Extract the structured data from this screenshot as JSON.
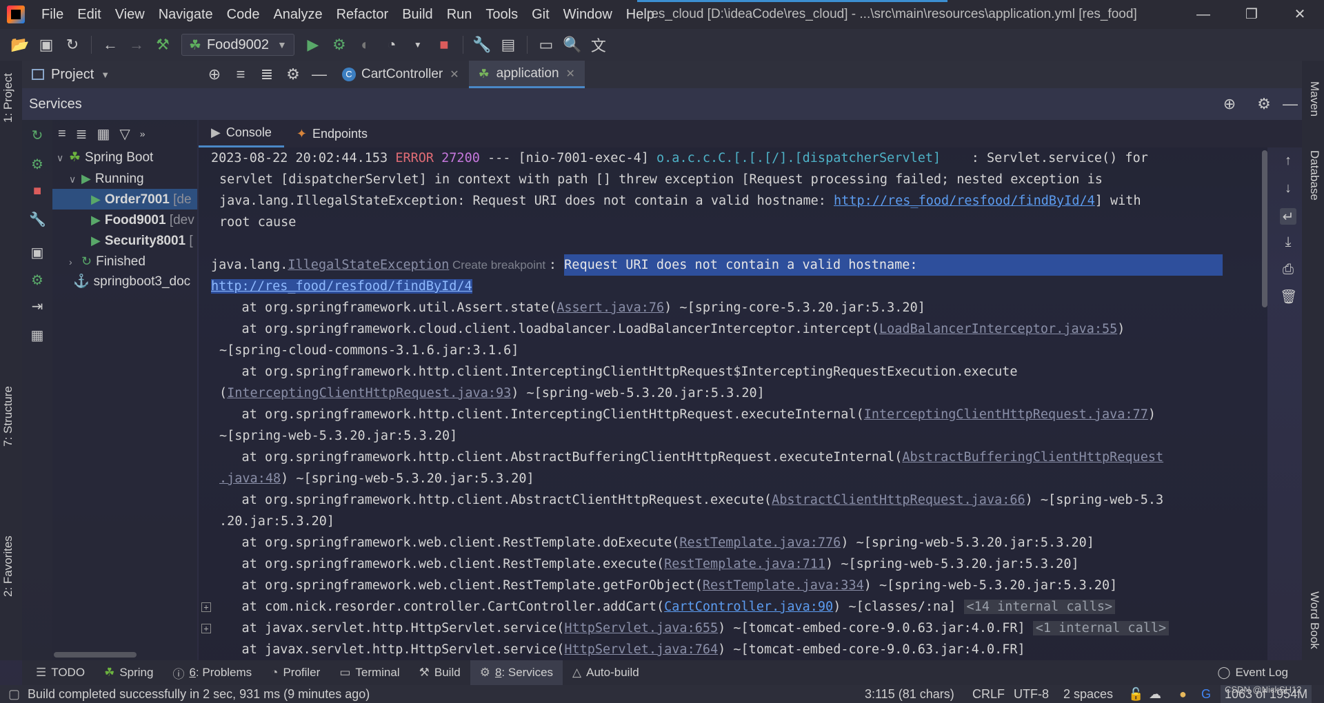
{
  "menubar": {
    "items": [
      "File",
      "Edit",
      "View",
      "Navigate",
      "Code",
      "Analyze",
      "Refactor",
      "Build",
      "Run",
      "Tools",
      "Git",
      "Window",
      "Help"
    ],
    "title": "res_cloud [D:\\ideaCode\\res_cloud] - ...\\src\\main\\resources\\application.yml [res_food]"
  },
  "toolbar": {
    "run_config": "Food9002"
  },
  "left_stripe": {
    "project": "1: Project",
    "structure": "7: Structure",
    "favorites": "2: Favorites"
  },
  "right_stripe": {
    "maven": "Maven",
    "database": "Database",
    "wordbook": "Word Book"
  },
  "tabs_row": {
    "project_label": "Project",
    "tabs": [
      {
        "label": "CartController",
        "active": false
      },
      {
        "label": "application",
        "active": true
      }
    ]
  },
  "services": {
    "title": "Services",
    "tree": {
      "spring_boot": "Spring Boot",
      "running": "Running",
      "apps": [
        {
          "name": "Order7001",
          "suffix": "[de",
          "selected": true
        },
        {
          "name": "Food9001",
          "suffix": "[dev",
          "selected": false
        },
        {
          "name": "Security8001",
          "suffix": "[",
          "selected": false
        }
      ],
      "finished": "Finished",
      "docker": "springboot3_doc"
    },
    "console_tabs": [
      "Console",
      "Endpoints"
    ]
  },
  "console": {
    "l1_ts": "2023-08-22 20:02:44.153 ",
    "l1_level": "ERROR",
    "l1_pid": " 27200",
    "l1_thread": " --- [nio-7001-exec-4] ",
    "l1_logger": "o.a.c.c.C.[.[.[/].[dispatcherServlet]",
    "l1_msg": "    : Servlet.service() for",
    "l2": "servlet [dispatcherServlet] in context with path [] threw exception [Request processing failed; nested exception is",
    "l3_pre": "java.lang.IllegalStateException: Request URI does not contain a valid hostname: ",
    "l3_link": "http://res_food/resfood/findById/4",
    "l3_post": "] with",
    "l4": "root cause",
    "l5_pre": "java.lang.",
    "l5_exc": "IllegalStateException",
    "l5_bp": " Create breakpoint ",
    "l5_sep": ": ",
    "l5_msg": "Request URI does not contain a valid hostname: ",
    "l6_link": "http://res_food/resfood/findById/4",
    "l7_pre": "    at org.springframework.util.Assert.state(",
    "l7_link": "Assert.java:76",
    "l7_post": ") ~[spring-core-5.3.20.jar:5.3.20]",
    "l8_pre": "    at org.springframework.cloud.client.loadbalancer.LoadBalancerInterceptor.intercept(",
    "l8_link": "LoadBalancerInterceptor.java:55",
    "l8_post": ")",
    "l9": "~[spring-cloud-commons-3.1.6.jar:3.1.6]",
    "l10": "    at org.springframework.http.client.InterceptingClientHttpRequest$InterceptingRequestExecution.execute",
    "l11_pre": "(",
    "l11_link": "InterceptingClientHttpRequest.java:93",
    "l11_post": ") ~[spring-web-5.3.20.jar:5.3.20]",
    "l12_pre": "    at org.springframework.http.client.InterceptingClientHttpRequest.executeInternal(",
    "l12_link": "InterceptingClientHttpRequest.java:77",
    "l12_post": ")",
    "l13": "~[spring-web-5.3.20.jar:5.3.20]",
    "l14_pre": "    at org.springframework.http.client.AbstractBufferingClientHttpRequest.executeInternal(",
    "l14_link": "AbstractBufferingClientHttpRequest",
    "l15_link": ".java:48",
    "l15_post": ") ~[spring-web-5.3.20.jar:5.3.20]",
    "l16_pre": "    at org.springframework.http.client.AbstractClientHttpRequest.execute(",
    "l16_link": "AbstractClientHttpRequest.java:66",
    "l16_post": ") ~[spring-web-5.3",
    "l17": ".20.jar:5.3.20]",
    "l18_pre": "    at org.springframework.web.client.RestTemplate.doExecute(",
    "l18_link": "RestTemplate.java:776",
    "l18_post": ") ~[spring-web-5.3.20.jar:5.3.20]",
    "l19_pre": "    at org.springframework.web.client.RestTemplate.execute(",
    "l19_link": "RestTemplate.java:711",
    "l19_post": ") ~[spring-web-5.3.20.jar:5.3.20]",
    "l20_pre": "    at org.springframework.web.client.RestTemplate.getForObject(",
    "l20_link": "RestTemplate.java:334",
    "l20_post": ") ~[spring-web-5.3.20.jar:5.3.20]",
    "l21_pre": "    at com.nick.resorder.controller.CartController.addCart(",
    "l21_link": "CartController.java:90",
    "l21_post": ") ~[classes/:na] ",
    "l21_hint": "<14 internal calls>",
    "l22_pre": "    at javax.servlet.http.HttpServlet.service(",
    "l22_link": "HttpServlet.java:655",
    "l22_post": ") ~[tomcat-embed-core-9.0.63.jar:4.0.FR] ",
    "l22_hint": "<1 internal call>",
    "l23_pre": "    at javax.servlet.http.HttpServlet.service(",
    "l23_link": "HttpServlet.java:764",
    "l23_post": ") ~[tomcat-embed-core-9.0.63.jar:4.0.FR]"
  },
  "bottom_tools": [
    {
      "num": "",
      "label": "TODO",
      "icon": "list-icon"
    },
    {
      "num": "",
      "label": "Spring",
      "icon": "spring-leaf-icon"
    },
    {
      "num": "6",
      "label": ": Problems",
      "icon": "info-icon"
    },
    {
      "num": "",
      "label": "Profiler",
      "icon": "profiler-icon"
    },
    {
      "num": "",
      "label": "Terminal",
      "icon": "terminal-icon"
    },
    {
      "num": "",
      "label": "Build",
      "icon": "hammer-icon"
    },
    {
      "num": "8",
      "label": ": Services",
      "icon": "services-icon",
      "active": true
    },
    {
      "num": "",
      "label": "Auto-build",
      "icon": "triangle-icon"
    }
  ],
  "event_log": "Event Log",
  "status": {
    "message": "Build completed successfully in 2 sec, 931 ms (9 minutes ago)",
    "position": "3:115 (81 chars)",
    "line_sep": "CRLF",
    "encoding": "UTF-8",
    "indent": "2 spaces",
    "memory": "1063 of 1954M",
    "watermark": "CSDN @NickSH12"
  }
}
